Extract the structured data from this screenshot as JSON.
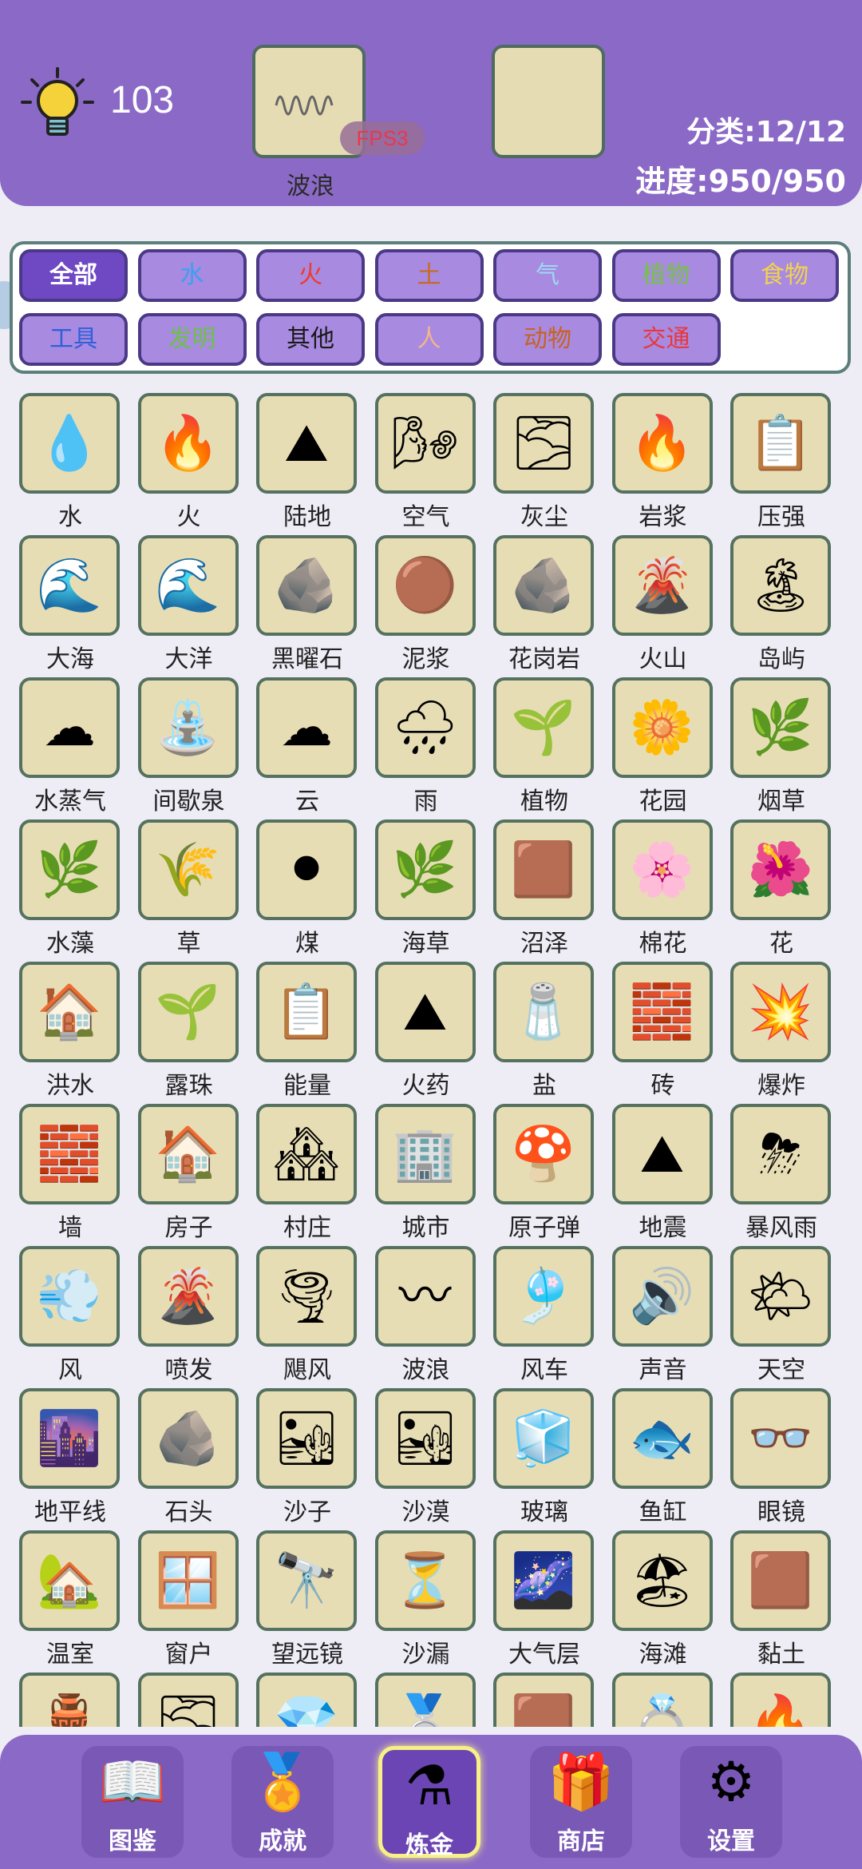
{
  "header": {
    "hint_count": "103",
    "slot1_label": "波浪",
    "fps_badge": "FPS3",
    "category_count": "分类:12/12",
    "progress": "进度:950/950"
  },
  "filters": [
    {
      "label": "全部",
      "color": "#ffffff",
      "active": true
    },
    {
      "label": "水",
      "color": "#3aa0f0"
    },
    {
      "label": "火",
      "color": "#f03a2a"
    },
    {
      "label": "土",
      "color": "#c86a22"
    },
    {
      "label": "气",
      "color": "#9fd8f2"
    },
    {
      "label": "植物",
      "color": "#76c04a"
    },
    {
      "label": "食物",
      "color": "#f2d24e"
    },
    {
      "label": "工具",
      "color": "#3060d8"
    },
    {
      "label": "发明",
      "color": "#6cc04a"
    },
    {
      "label": "其他",
      "color": "#1a1a1a"
    },
    {
      "label": "人",
      "color": "#f2b48c"
    },
    {
      "label": "动物",
      "color": "#c8621e"
    },
    {
      "label": "交通",
      "color": "#e8383e"
    }
  ],
  "items": [
    {
      "label": "水",
      "icon": "water-drop-icon",
      "glyph": "💧"
    },
    {
      "label": "火",
      "icon": "fire-icon",
      "glyph": "🔥"
    },
    {
      "label": "陆地",
      "icon": "land-icon",
      "glyph": "⛰"
    },
    {
      "label": "空气",
      "icon": "air-icon",
      "glyph": "🌬"
    },
    {
      "label": "灰尘",
      "icon": "dust-icon",
      "glyph": "🌫"
    },
    {
      "label": "岩浆",
      "icon": "lava-icon",
      "glyph": "🔥"
    },
    {
      "label": "压强",
      "icon": "pressure-board-icon",
      "glyph": "📋"
    },
    {
      "label": "大海",
      "icon": "sea-icon",
      "glyph": "🌊"
    },
    {
      "label": "大洋",
      "icon": "ocean-icon",
      "glyph": "🌊"
    },
    {
      "label": "黑曜石",
      "icon": "obsidian-icon",
      "glyph": "🪨"
    },
    {
      "label": "泥浆",
      "icon": "mud-icon",
      "glyph": "🟤"
    },
    {
      "label": "花岗岩",
      "icon": "granite-icon",
      "glyph": "🪨"
    },
    {
      "label": "火山",
      "icon": "volcano-icon",
      "glyph": "🌋"
    },
    {
      "label": "岛屿",
      "icon": "island-icon",
      "glyph": "🏝"
    },
    {
      "label": "水蒸气",
      "icon": "steam-icon",
      "glyph": "☁"
    },
    {
      "label": "间歇泉",
      "icon": "geyser-icon",
      "glyph": "⛲"
    },
    {
      "label": "云",
      "icon": "cloud-icon",
      "glyph": "☁"
    },
    {
      "label": "雨",
      "icon": "rain-icon",
      "glyph": "🌧"
    },
    {
      "label": "植物",
      "icon": "plant-icon",
      "glyph": "🌱"
    },
    {
      "label": "花园",
      "icon": "garden-icon",
      "glyph": "🌼"
    },
    {
      "label": "烟草",
      "icon": "tobacco-leaf-icon",
      "glyph": "🌿"
    },
    {
      "label": "水藻",
      "icon": "algae-icon",
      "glyph": "🌿"
    },
    {
      "label": "草",
      "icon": "grass-icon",
      "glyph": "🌾"
    },
    {
      "label": "煤",
      "icon": "coal-icon",
      "glyph": "⚫"
    },
    {
      "label": "海草",
      "icon": "seaweed-icon",
      "glyph": "🌿"
    },
    {
      "label": "沼泽",
      "icon": "swamp-icon",
      "glyph": "🟫"
    },
    {
      "label": "棉花",
      "icon": "cotton-icon",
      "glyph": "🌸"
    },
    {
      "label": "花",
      "icon": "flower-icon",
      "glyph": "🌺"
    },
    {
      "label": "洪水",
      "icon": "flood-icon",
      "glyph": "🏠"
    },
    {
      "label": "露珠",
      "icon": "dew-icon",
      "glyph": "🌱"
    },
    {
      "label": "能量",
      "icon": "energy-board-icon",
      "glyph": "📋"
    },
    {
      "label": "火药",
      "icon": "gunpowder-icon",
      "glyph": "⛰"
    },
    {
      "label": "盐",
      "icon": "salt-icon",
      "glyph": "🧂"
    },
    {
      "label": "砖",
      "icon": "brick-icon",
      "glyph": "🧱"
    },
    {
      "label": "爆炸",
      "icon": "explosion-icon",
      "glyph": "💥"
    },
    {
      "label": "墙",
      "icon": "wall-icon",
      "glyph": "🧱"
    },
    {
      "label": "房子",
      "icon": "house-icon",
      "glyph": "🏠"
    },
    {
      "label": "村庄",
      "icon": "village-icon",
      "glyph": "🏘"
    },
    {
      "label": "城市",
      "icon": "city-icon",
      "glyph": "🏢"
    },
    {
      "label": "原子弹",
      "icon": "atomic-bomb-icon",
      "glyph": "🍄"
    },
    {
      "label": "地震",
      "icon": "earthquake-icon",
      "glyph": "⛰"
    },
    {
      "label": "暴风雨",
      "icon": "storm-icon",
      "glyph": "⛈"
    },
    {
      "label": "风",
      "icon": "wind-icon",
      "glyph": "💨"
    },
    {
      "label": "喷发",
      "icon": "eruption-icon",
      "glyph": "🌋"
    },
    {
      "label": "飓风",
      "icon": "hurricane-icon",
      "glyph": "🌪"
    },
    {
      "label": "波浪",
      "icon": "wave-icon",
      "glyph": "〰"
    },
    {
      "label": "风车",
      "icon": "windmill-icon",
      "glyph": "🎐"
    },
    {
      "label": "声音",
      "icon": "sound-icon",
      "glyph": "🔊"
    },
    {
      "label": "天空",
      "icon": "sky-icon",
      "glyph": "🌤"
    },
    {
      "label": "地平线",
      "icon": "horizon-icon",
      "glyph": "🌆"
    },
    {
      "label": "石头",
      "icon": "stone-icon",
      "glyph": "🪨"
    },
    {
      "label": "沙子",
      "icon": "sand-icon",
      "glyph": "🏜"
    },
    {
      "label": "沙漠",
      "icon": "desert-icon",
      "glyph": "🏜"
    },
    {
      "label": "玻璃",
      "icon": "glass-icon",
      "glyph": "🧊"
    },
    {
      "label": "鱼缸",
      "icon": "fishbowl-icon",
      "glyph": "🐟"
    },
    {
      "label": "眼镜",
      "icon": "glasses-icon",
      "glyph": "👓"
    },
    {
      "label": "温室",
      "icon": "greenhouse-icon",
      "glyph": "🏡"
    },
    {
      "label": "窗户",
      "icon": "window-icon",
      "glyph": "🪟"
    },
    {
      "label": "望远镜",
      "icon": "telescope-icon",
      "glyph": "🔭"
    },
    {
      "label": "沙漏",
      "icon": "hourglass-icon",
      "glyph": "⏳"
    },
    {
      "label": "大气层",
      "icon": "atmosphere-icon",
      "glyph": "🌌"
    },
    {
      "label": "海滩",
      "icon": "beach-icon",
      "glyph": "🏖"
    },
    {
      "label": "黏土",
      "icon": "clay-icon",
      "glyph": "🟫"
    },
    {
      "label": "",
      "icon": "vase-icon",
      "glyph": "🏺"
    },
    {
      "label": "",
      "icon": "smoke-icon",
      "glyph": "🌫"
    },
    {
      "label": "",
      "icon": "diamond-icon",
      "glyph": "💎"
    },
    {
      "label": "",
      "icon": "metal-icon",
      "glyph": "🥈"
    },
    {
      "label": "",
      "icon": "rust-icon",
      "glyph": "🟫"
    },
    {
      "label": "",
      "icon": "ring-icon",
      "glyph": "💍"
    },
    {
      "label": "",
      "icon": "fire-card-icon",
      "glyph": "🔥"
    }
  ],
  "nav": [
    {
      "label": "图鉴",
      "icon": "encyclopedia-book-icon",
      "glyph": "📖"
    },
    {
      "label": "成就",
      "icon": "achievement-medal-icon",
      "glyph": "🏅"
    },
    {
      "label": "炼金",
      "icon": "alchemy-flask-icon",
      "glyph": "⚗",
      "active": true
    },
    {
      "label": "商店",
      "icon": "shop-gift-icon",
      "glyph": "🎁"
    },
    {
      "label": "设置",
      "icon": "settings-gear-icon",
      "glyph": "⚙"
    }
  ]
}
